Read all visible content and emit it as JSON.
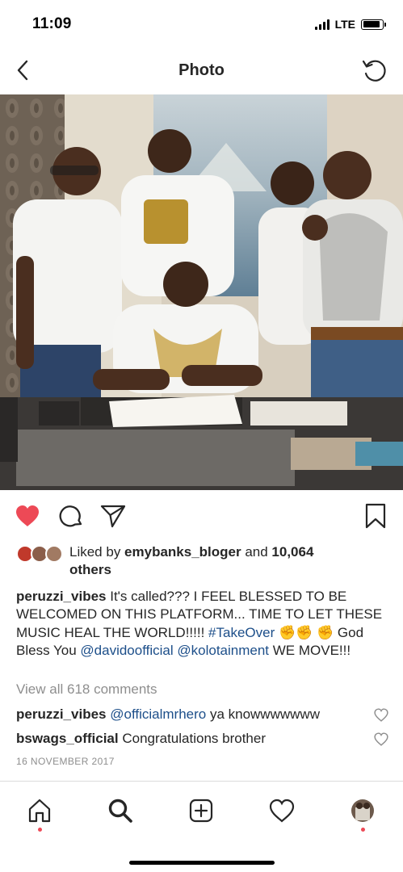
{
  "status_bar": {
    "time": "11:09",
    "network": "LTE",
    "battery_level": 0.9
  },
  "header": {
    "title": "Photo"
  },
  "post": {
    "liked": true,
    "likes": {
      "prefix": "Liked by ",
      "user": "emybanks_bloger",
      "middle": " and ",
      "count": "10,064",
      "suffix": "others"
    },
    "caption": {
      "username": "peruzzi_vibes",
      "text_1": " It's called??? I FEEL BLESSED TO BE WELCOMED ON THIS PLATFORM... TIME TO LET THESE MUSIC HEAL THE WORLD!!!!! ",
      "hashtag": "#TakeOver",
      "text_2": " ✊✊ ✊ God Bless You ",
      "mention_1": "@davidoofficial",
      "text_3": " ",
      "mention_2": "@kolotainment",
      "text_4": " WE MOVE!!!"
    },
    "view_all_comments": "View all 618 comments",
    "comments": [
      {
        "username": "peruzzi_vibes",
        "mention": "@officialmrhero",
        "text": " ya knowwwwwww"
      },
      {
        "username": "bswags_official",
        "mention": "",
        "text": " Congratulations brother"
      }
    ],
    "date": "16 NOVEMBER 2017"
  },
  "colors": {
    "like": "#ed4956",
    "link": "#1d4f8a",
    "muted": "#8e8e8e",
    "notification_dot": "#ed4956"
  },
  "icons": {
    "back": "chevron-left-icon",
    "refresh": "refresh-icon",
    "like": "heart-icon",
    "comment": "comment-icon",
    "share": "paper-plane-icon",
    "save": "bookmark-icon",
    "home": "home-icon",
    "search": "search-icon",
    "new_post": "add-post-icon",
    "activity": "heart-outline-icon",
    "profile": "profile-avatar"
  }
}
